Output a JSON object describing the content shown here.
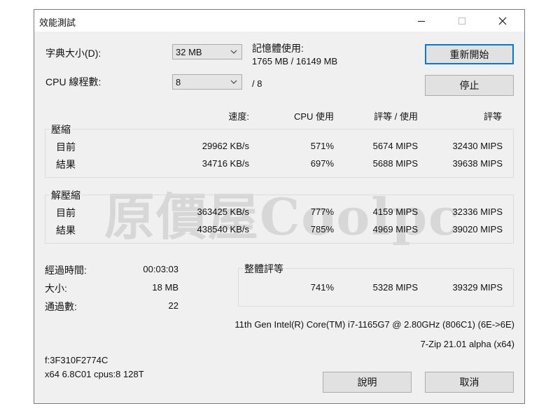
{
  "window": {
    "title": "效能測試"
  },
  "settings": {
    "dict_label": "字典大小(D):",
    "dict_value": "32 MB",
    "threads_label": "CPU 線程數:",
    "threads_value": "8",
    "threads_total": "/ 8",
    "memory_label": "記憶體使用:",
    "memory_value": "1765 MB / 16149 MB"
  },
  "buttons": {
    "restart": "重新開始",
    "stop": "停止",
    "help": "說明",
    "cancel": "取消"
  },
  "headers": {
    "speed": "速度:",
    "cpu": "CPU 使用",
    "rating_usage": "評等 / 使用",
    "rating": "評等"
  },
  "compress": {
    "label": "壓縮",
    "current": {
      "label": "目前",
      "speed": "29962 KB/s",
      "cpu": "571%",
      "rating_usage": "5674 MIPS",
      "rating": "32430 MIPS"
    },
    "result": {
      "label": "結果",
      "speed": "34716 KB/s",
      "cpu": "697%",
      "rating_usage": "5688 MIPS",
      "rating": "39638 MIPS"
    }
  },
  "decompress": {
    "label": "解壓縮",
    "current": {
      "label": "目前",
      "speed": "363425 KB/s",
      "cpu": "777%",
      "rating_usage": "4159 MIPS",
      "rating": "32336 MIPS"
    },
    "result": {
      "label": "結果",
      "speed": "438540 KB/s",
      "cpu": "785%",
      "rating_usage": "4969 MIPS",
      "rating": "39020 MIPS"
    }
  },
  "stats": {
    "elapsed_label": "經過時間:",
    "elapsed_value": "00:03:03",
    "size_label": "大小:",
    "size_value": "18 MB",
    "passes_label": "通過數:",
    "passes_value": "22"
  },
  "overall": {
    "label": "整體評等",
    "cpu": "741%",
    "rating_usage": "5328 MIPS",
    "rating": "39329 MIPS"
  },
  "cpu_info": "11th Gen Intel(R) Core(TM) i7-1165G7 @ 2.80GHz (806C1) (6E->6E)",
  "version": "7-Zip 21.01 alpha (x64)",
  "footer": {
    "line1": "f:3F310F2774C",
    "line2": "x64 6.8C01 cpus:8 128T"
  },
  "watermark": "原價屋Coolpc"
}
